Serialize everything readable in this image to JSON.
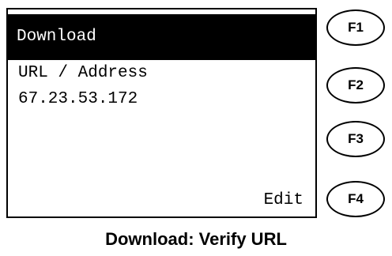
{
  "screen": {
    "title": "Download",
    "lines": [
      "URL / Address",
      "67.23.53.172"
    ],
    "softkey_label": "Edit"
  },
  "function_keys": [
    "F1",
    "F2",
    "F3",
    "F4"
  ],
  "caption": "Download: Verify URL"
}
